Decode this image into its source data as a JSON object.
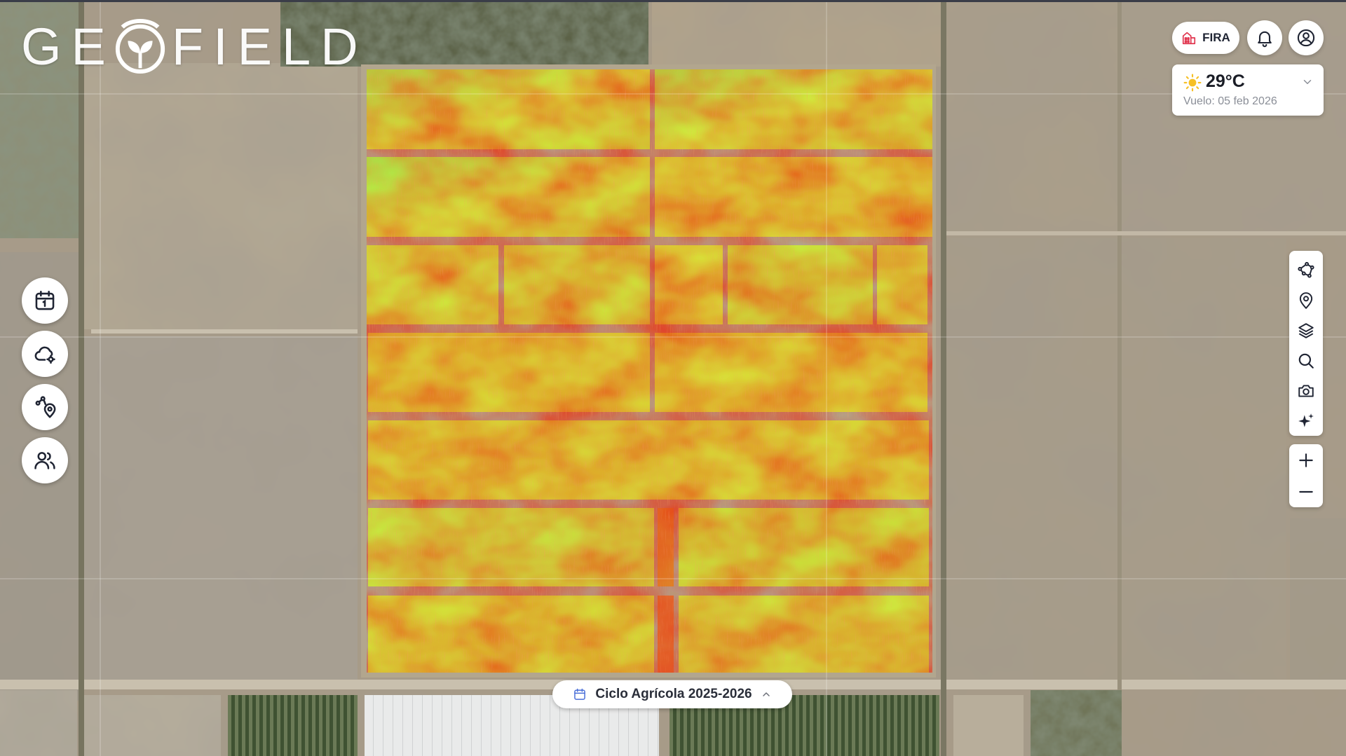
{
  "app": {
    "logo_text_left": "GE",
    "logo_text_right": "FIELD"
  },
  "top_right": {
    "fira_label": "FIRA",
    "fira_icon": "chart-building-icon",
    "notifications_icon": "bell-icon",
    "profile_icon": "user-circle-icon"
  },
  "weather": {
    "temperature": "29°C",
    "flight_date": "Vuelo: 05 feb 2026",
    "icon": "sun-icon"
  },
  "left_tools": [
    {
      "name": "calendar-button",
      "icon": "calendar-icon"
    },
    {
      "name": "cloud-settings-button",
      "icon": "cloud-gear-icon"
    },
    {
      "name": "route-location-button",
      "icon": "route-pin-icon"
    },
    {
      "name": "users-button",
      "icon": "users-icon"
    }
  ],
  "right_tools": [
    {
      "name": "draw-polygon-button",
      "icon": "polygon-icon"
    },
    {
      "name": "location-pin-button",
      "icon": "map-pin-icon"
    },
    {
      "name": "layers-button",
      "icon": "layers-icon"
    },
    {
      "name": "search-button",
      "icon": "search-icon"
    },
    {
      "name": "camera-button",
      "icon": "camera-icon"
    },
    {
      "name": "ai-sparkle-button",
      "icon": "sparkle-icon"
    }
  ],
  "zoom": {
    "in_icon": "plus-icon",
    "out_icon": "minus-icon"
  },
  "cycle": {
    "label": "Ciclo Agrícola 2025-2026",
    "icon": "calendar-icon",
    "chevron": "chevron-up-icon"
  },
  "colors": {
    "ndvi_high": "#8ef04a",
    "ndvi_mid": "#d8e63a",
    "ndvi_low": "#e8401e",
    "soil": "#a89a84",
    "ui_text": "#1f2433",
    "fira_red": "#e0334d"
  }
}
